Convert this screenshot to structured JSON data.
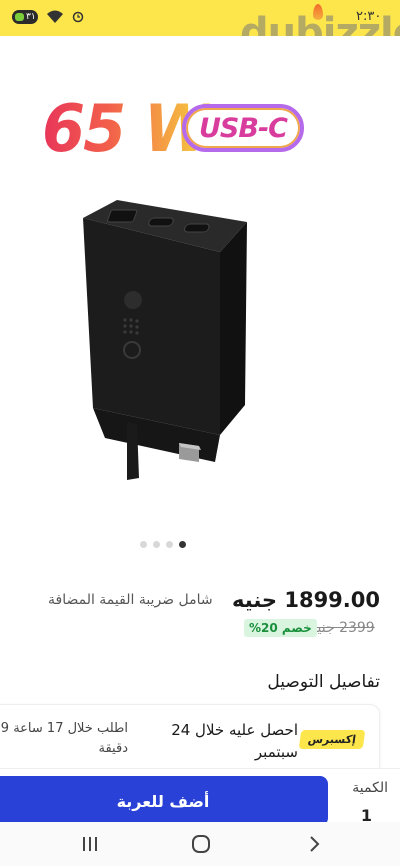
{
  "status_bar": {
    "battery": "٣١",
    "time": "٢:٣٠"
  },
  "watermark": {
    "text": "dubizzle"
  },
  "product_image": {
    "watt_label": "65 W",
    "usbc_label": "USB-C",
    "carousel_count": 4,
    "carousel_active": 4
  },
  "pricing": {
    "price": "1899.00 جنيه",
    "vat_note": "شامل ضريبة القيمة المضافة",
    "old_price": "2399 جنيه",
    "discount": "خصم 20%"
  },
  "delivery": {
    "title": "تفاصيل التوصيل",
    "express_badge": "إكسبرس",
    "main_text": "احصل عليه خلال 24 سبتمبر",
    "order_text": "اطلب خلال 17 ساعة 9 دقيقة"
  },
  "actions": {
    "add_to_cart": "أضف للعربة",
    "quantity_label": "الكمية",
    "quantity_value": "1"
  },
  "colors": {
    "status_bar": "#fde64b",
    "cta": "#2941d6",
    "discount_text": "#1a8f3c",
    "discount_bg": "#d9f5df"
  },
  "icons": {
    "nav_recent": "recent-apps-icon",
    "nav_home": "home-icon",
    "nav_back": "back-icon"
  }
}
